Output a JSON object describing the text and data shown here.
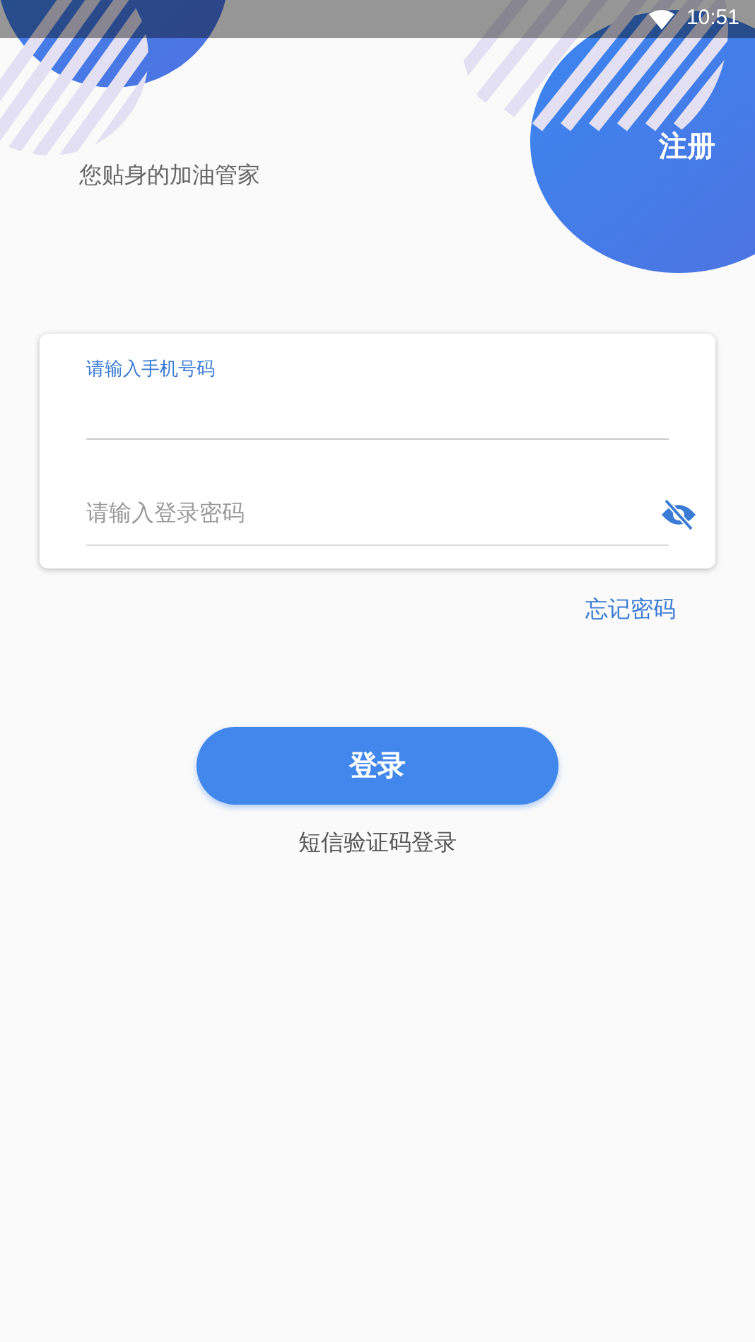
{
  "status_bar": {
    "time": "10:51"
  },
  "header": {
    "tagline": "您贴身的加油管家",
    "register": "注册"
  },
  "login_card": {
    "phone": {
      "label": "请输入手机号码",
      "focused": true
    },
    "password": {
      "placeholder": "请输入登录密码",
      "hidden": true
    }
  },
  "forgot_password": "忘记密码",
  "login_button": "登录",
  "sms_login": "短信验证码登录"
}
